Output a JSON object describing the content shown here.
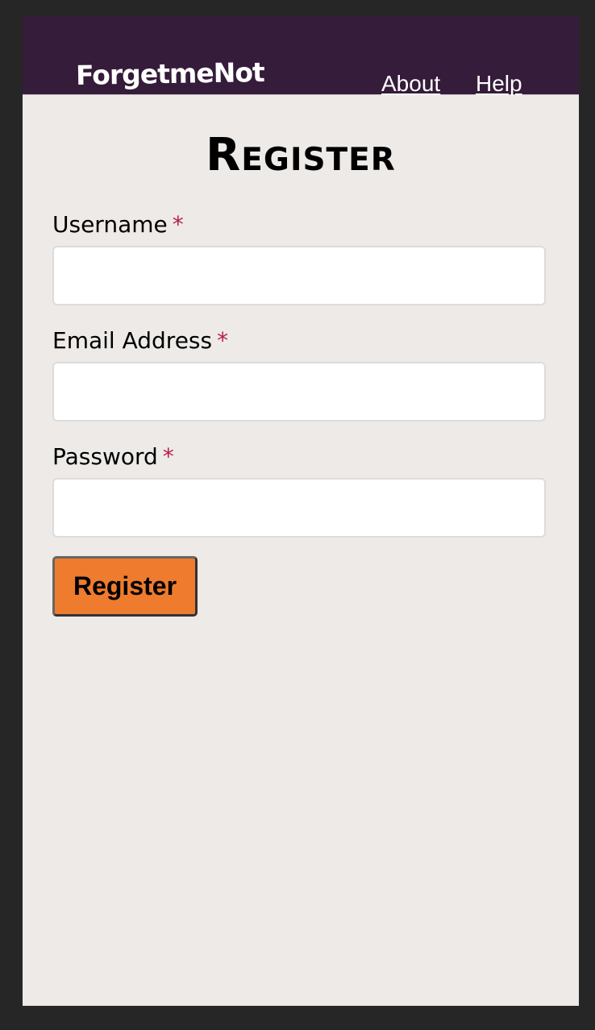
{
  "header": {
    "logo": "ForgetmeNot",
    "nav": {
      "about": "About",
      "help": "Help"
    }
  },
  "form": {
    "title": "Register",
    "required_marker": "*",
    "fields": {
      "username": {
        "label": "Username",
        "value": "",
        "placeholder": ""
      },
      "email": {
        "label": "Email Address",
        "value": "",
        "placeholder": ""
      },
      "password": {
        "label": "Password",
        "value": "",
        "placeholder": ""
      }
    },
    "submit_label": "Register"
  },
  "colors": {
    "header_bg": "#351c3a",
    "page_bg": "#edeae7",
    "outer_bg": "#262626",
    "button_bg": "#ee7b2e",
    "required": "#b51f55"
  }
}
